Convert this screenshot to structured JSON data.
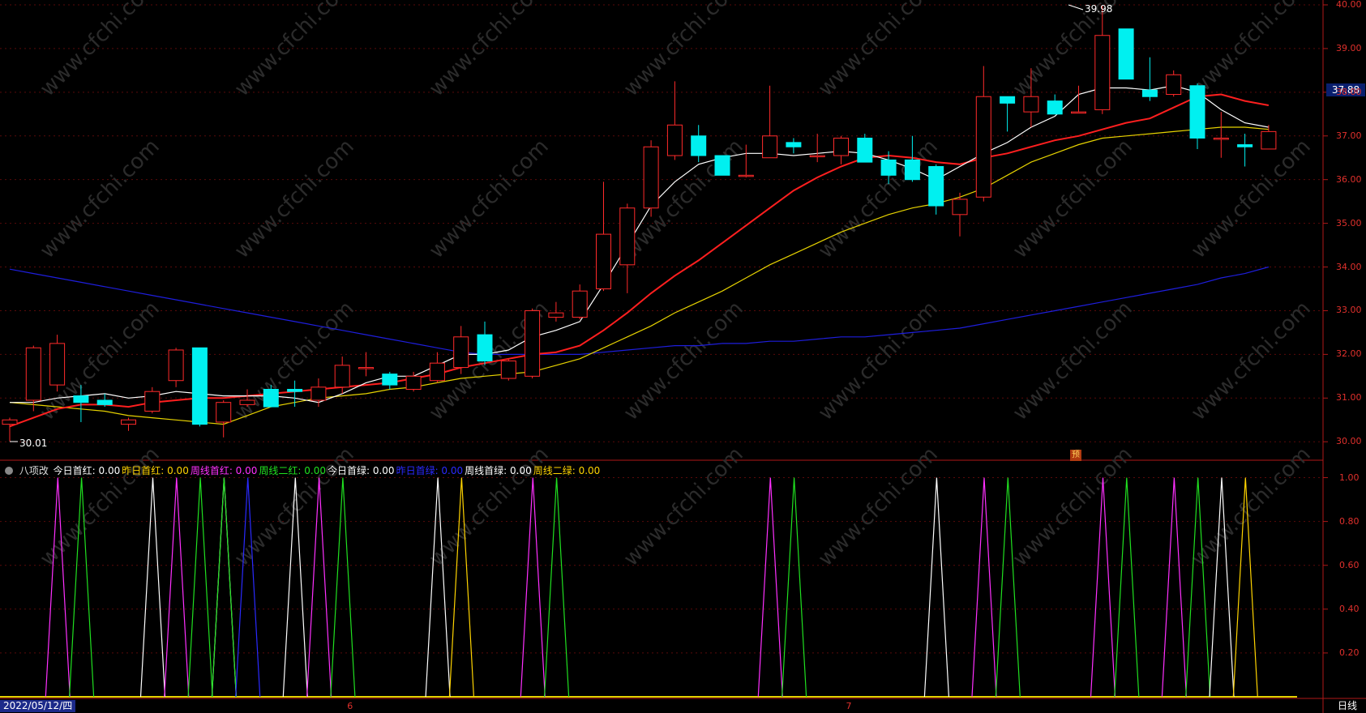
{
  "chart_data": [
    {
      "type": "candlestick",
      "name": "price",
      "ylim": [
        29.8,
        40.0
      ],
      "yticks": [
        "40.00",
        "39.00",
        "38.00",
        "37.00",
        "36.00",
        "35.00",
        "34.00",
        "33.00",
        "32.00",
        "31.00",
        "30.00"
      ],
      "last_price": "37.88",
      "high_label": "39.98",
      "low_label": "30.01",
      "pre_marker": "预",
      "candles": [
        [
          30.4,
          30.55,
          30.01,
          30.5
        ],
        [
          30.95,
          32.2,
          30.7,
          32.15
        ],
        [
          31.3,
          32.45,
          31.15,
          32.25
        ],
        [
          31.05,
          31.3,
          30.45,
          30.9
        ],
        [
          30.95,
          31.1,
          30.8,
          30.85
        ],
        [
          30.4,
          30.55,
          30.25,
          30.5
        ],
        [
          30.7,
          31.25,
          30.65,
          31.15
        ],
        [
          31.4,
          32.15,
          31.25,
          32.1
        ],
        [
          32.15,
          32.15,
          30.35,
          30.4
        ],
        [
          30.45,
          30.95,
          30.1,
          30.9
        ],
        [
          30.85,
          31.2,
          30.8,
          30.95
        ],
        [
          31.2,
          31.3,
          30.8,
          30.8
        ],
        [
          31.2,
          31.4,
          30.8,
          31.15
        ],
        [
          30.95,
          31.45,
          30.8,
          31.25
        ],
        [
          31.25,
          31.95,
          31.1,
          31.75
        ],
        [
          31.7,
          32.05,
          31.5,
          31.7
        ],
        [
          31.55,
          31.6,
          31.2,
          31.3
        ],
        [
          31.2,
          31.6,
          31.15,
          31.5
        ],
        [
          31.4,
          32.05,
          31.35,
          31.8
        ],
        [
          31.7,
          32.65,
          31.55,
          32.4
        ],
        [
          32.45,
          32.75,
          31.75,
          31.85
        ],
        [
          31.45,
          31.9,
          31.4,
          31.85
        ],
        [
          31.5,
          33.05,
          31.45,
          33.0
        ],
        [
          32.85,
          33.2,
          32.75,
          32.95
        ],
        [
          32.85,
          33.6,
          32.8,
          33.45
        ],
        [
          33.5,
          35.95,
          33.45,
          34.75
        ],
        [
          34.05,
          35.45,
          33.4,
          35.35
        ],
        [
          35.35,
          36.9,
          35.15,
          36.75
        ],
        [
          36.55,
          38.25,
          36.45,
          37.25
        ],
        [
          37.0,
          37.25,
          36.4,
          36.55
        ],
        [
          36.55,
          36.55,
          36.1,
          36.1
        ],
        [
          36.1,
          36.8,
          36.05,
          36.1
        ],
        [
          36.5,
          38.15,
          36.55,
          37.0
        ],
        [
          36.85,
          36.95,
          36.6,
          36.75
        ],
        [
          36.55,
          37.05,
          36.4,
          36.55
        ],
        [
          36.55,
          37.0,
          36.35,
          36.95
        ],
        [
          36.95,
          37.05,
          36.4,
          36.4
        ],
        [
          36.45,
          36.65,
          35.9,
          36.1
        ],
        [
          36.45,
          37.0,
          35.95,
          36.0
        ],
        [
          36.3,
          36.35,
          35.2,
          35.4
        ],
        [
          35.2,
          35.7,
          34.7,
          35.55
        ],
        [
          35.6,
          38.6,
          35.5,
          37.9
        ],
        [
          37.9,
          37.9,
          37.1,
          37.75
        ],
        [
          37.55,
          38.55,
          37.2,
          37.9
        ],
        [
          37.8,
          37.95,
          37.5,
          37.5
        ],
        [
          37.55,
          38.15,
          37.55,
          37.55
        ],
        [
          37.6,
          39.98,
          37.5,
          39.3
        ],
        [
          39.45,
          39.45,
          38.3,
          38.3
        ],
        [
          38.05,
          38.8,
          37.8,
          37.9
        ],
        [
          37.95,
          38.5,
          37.9,
          38.4
        ],
        [
          38.15,
          38.2,
          36.7,
          36.95
        ],
        [
          36.95,
          37.55,
          36.5,
          36.95
        ],
        [
          36.8,
          37.05,
          36.3,
          36.75
        ],
        [
          36.7,
          37.25,
          36.7,
          37.1
        ]
      ],
      "series": [
        {
          "name": "",
          "color": "#ffffff",
          "values": [
            30.9,
            30.9,
            31.0,
            31.05,
            31.1,
            31.0,
            31.05,
            31.15,
            31.1,
            31.05,
            31.05,
            31.05,
            31.0,
            30.9,
            31.1,
            31.35,
            31.5,
            31.5,
            31.75,
            32.0,
            32.0,
            32.1,
            32.4,
            32.55,
            32.75,
            33.6,
            34.5,
            35.4,
            35.95,
            36.35,
            36.5,
            36.6,
            36.6,
            36.55,
            36.6,
            36.65,
            36.6,
            36.45,
            36.25,
            36.0,
            36.3,
            36.6,
            36.85,
            37.2,
            37.45,
            37.95,
            38.1,
            38.1,
            38.05,
            38.15,
            38.0,
            37.6,
            37.3,
            37.2
          ]
        },
        {
          "name": "",
          "color": "#ff1f1f",
          "values": [
            30.35,
            30.55,
            30.75,
            30.85,
            30.85,
            30.8,
            30.9,
            30.95,
            31.0,
            31.0,
            31.05,
            31.1,
            31.15,
            31.2,
            31.25,
            31.3,
            31.35,
            31.45,
            31.55,
            31.7,
            31.8,
            31.9,
            32.0,
            32.05,
            32.2,
            32.55,
            32.95,
            33.4,
            33.8,
            34.15,
            34.55,
            34.95,
            35.35,
            35.75,
            36.05,
            36.3,
            36.5,
            36.55,
            36.5,
            36.4,
            36.35,
            36.5,
            36.6,
            36.75,
            36.9,
            37.0,
            37.15,
            37.3,
            37.4,
            37.65,
            37.9,
            37.95,
            37.8,
            37.7
          ]
        },
        {
          "name": "",
          "color": "#e6d200",
          "values": [
            30.9,
            30.85,
            30.8,
            30.75,
            30.7,
            30.6,
            30.55,
            30.5,
            30.45,
            30.4,
            30.6,
            30.8,
            30.9,
            31.0,
            31.05,
            31.1,
            31.2,
            31.25,
            31.35,
            31.45,
            31.5,
            31.55,
            31.6,
            31.75,
            31.9,
            32.15,
            32.4,
            32.65,
            32.95,
            33.2,
            33.45,
            33.75,
            34.05,
            34.3,
            34.55,
            34.8,
            35.0,
            35.2,
            35.35,
            35.45,
            35.6,
            35.8,
            36.1,
            36.4,
            36.6,
            36.8,
            36.95,
            37.0,
            37.05,
            37.1,
            37.15,
            37.2,
            37.2,
            37.15
          ]
        },
        {
          "name": "",
          "color": "#1e1edc",
          "values": [
            33.95,
            33.85,
            33.75,
            33.65,
            33.55,
            33.45,
            33.35,
            33.25,
            33.15,
            33.05,
            32.95,
            32.85,
            32.75,
            32.65,
            32.55,
            32.45,
            32.35,
            32.25,
            32.15,
            32.05,
            32.0,
            32.0,
            32.0,
            32.0,
            32.0,
            32.05,
            32.1,
            32.15,
            32.2,
            32.2,
            32.25,
            32.25,
            32.3,
            32.3,
            32.35,
            32.4,
            32.4,
            32.45,
            32.5,
            32.55,
            32.6,
            32.7,
            32.8,
            32.9,
            33.0,
            33.1,
            33.2,
            33.3,
            33.4,
            33.5,
            33.6,
            33.75,
            33.85,
            34.0
          ]
        }
      ]
    },
    {
      "type": "line",
      "name": "八项改",
      "ylim": [
        0,
        1.05
      ],
      "yticks": [
        "1.00",
        "0.80",
        "0.60",
        "0.40",
        "0.20"
      ],
      "legend": [
        {
          "label": "今日首红: 0.00",
          "color": "#ffffff"
        },
        {
          "label": "昨日首红: 0.00",
          "color": "#ffd400"
        },
        {
          "label": "周线首红: 0.00",
          "color": "#ff30ff"
        },
        {
          "label": "周线二红: 0.00",
          "color": "#20e020"
        },
        {
          "label": "今日首绿: 0.00",
          "color": "#ffffff"
        },
        {
          "label": "昨日首绿: 0.00",
          "color": "#2a2aff"
        },
        {
          "label": "周线首绿: 0.00",
          "color": "#ffffff"
        },
        {
          "label": "周线二绿: 0.00",
          "color": "#ffd400"
        }
      ],
      "spikes": [
        {
          "i": 1,
          "color": "#ff30ff"
        },
        {
          "i": 2,
          "color": "#20e020"
        },
        {
          "i": 5,
          "color": "#ffffff"
        },
        {
          "i": 6,
          "color": "#ff30ff"
        },
        {
          "i": 7,
          "color": "#20e020"
        },
        {
          "i": 8,
          "color": "#ffffff"
        },
        {
          "i": 8,
          "color": "#20e020"
        },
        {
          "i": 9,
          "color": "#2a2aff"
        },
        {
          "i": 11,
          "color": "#ffffff"
        },
        {
          "i": 12,
          "color": "#ff30ff"
        },
        {
          "i": 13,
          "color": "#20e020"
        },
        {
          "i": 17,
          "color": "#ffffff"
        },
        {
          "i": 18,
          "color": "#ffd400"
        },
        {
          "i": 21,
          "color": "#ff30ff"
        },
        {
          "i": 22,
          "color": "#20e020"
        },
        {
          "i": 31,
          "color": "#ff30ff"
        },
        {
          "i": 32,
          "color": "#20e020"
        },
        {
          "i": 38,
          "color": "#ffffff"
        },
        {
          "i": 40,
          "color": "#ff30ff"
        },
        {
          "i": 41,
          "color": "#20e020"
        },
        {
          "i": 45,
          "color": "#ff30ff"
        },
        {
          "i": 46,
          "color": "#20e020"
        },
        {
          "i": 48,
          "color": "#ff30ff"
        },
        {
          "i": 49,
          "color": "#20e020"
        },
        {
          "i": 50,
          "color": "#ffffff"
        },
        {
          "i": 51,
          "color": "#ffd400"
        }
      ]
    }
  ],
  "status": {
    "date": "2022/05/12/四",
    "period": "日线",
    "months": [
      {
        "label": "6",
        "i": 14
      },
      {
        "label": "7",
        "i": 35
      }
    ]
  },
  "watermark": "www.cfchi.com"
}
